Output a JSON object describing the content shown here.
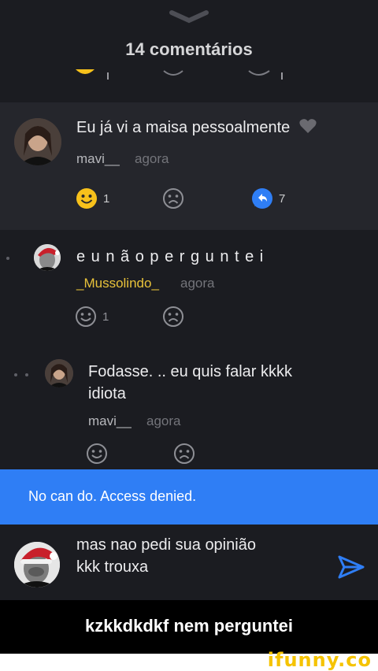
{
  "header": {
    "title": "14 comentários"
  },
  "comments": [
    {
      "text": "Eu já vi a maisa pessoalmente",
      "username": "mavi__",
      "time": "agora",
      "likes": "1",
      "replies": "7"
    },
    {
      "text": "e u n ã o p e r g u n t e i",
      "username": "_Mussolindo_",
      "time": "agora",
      "likes": "1"
    },
    {
      "text_line1": "Fodasse. .. eu quis falar kkkk",
      "text_line2": "idiota",
      "username": "mavi__",
      "time": "agora"
    }
  ],
  "toast": {
    "message": "No can do. Access denied."
  },
  "reply": {
    "line1": "mas nao pedi sua opinião",
    "line2": "kkk trouxa"
  },
  "caption": {
    "text": "kzkkdkdkf nem perguntei"
  },
  "watermark": {
    "text": "ifunny.co"
  },
  "colors": {
    "accent": "#2f7ef5",
    "username_highlight": "#e8c23a",
    "emoji_yellow": "#f7c11b"
  }
}
